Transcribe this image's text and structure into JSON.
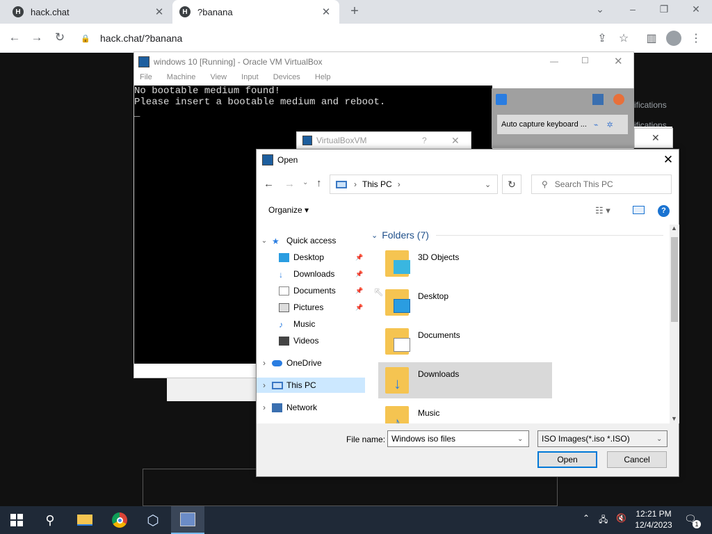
{
  "browser": {
    "tabs": [
      {
        "title": "hack.chat",
        "active": false
      },
      {
        "title": "?banana",
        "active": true
      }
    ],
    "url": "hack.chat/?banana"
  },
  "page_bg_text": {
    "line1": "ifications",
    "line2": "ifications"
  },
  "vbox": {
    "title": "windows 10 [Running] - Oracle VM VirtualBox",
    "menu": [
      "File",
      "Machine",
      "View",
      "Input",
      "Devices",
      "Help"
    ],
    "console": [
      "No bootable medium found!",
      "Please insert a bootable medium and reboot.",
      "_"
    ],
    "notice": "Auto capture keyboard ...",
    "vm_window_title": "VirtualBoxVM"
  },
  "dialog": {
    "title": "Open",
    "breadcrumb": "This PC",
    "search_placeholder": "Search This PC",
    "organize": "Organize",
    "nav": {
      "quick_access": "Quick access",
      "items": [
        "Desktop",
        "Downloads",
        "Documents",
        "Pictures",
        "Music",
        "Videos"
      ],
      "onedrive": "OneDrive",
      "this_pc": "This PC",
      "network": "Network"
    },
    "group_header": "Folders (7)",
    "folders": [
      "3D Objects",
      "Desktop",
      "Documents",
      "Downloads",
      "Music"
    ],
    "filename_label": "File name:",
    "filename_value": "Windows iso files",
    "filetype": "ISO Images(*.iso *.ISO)",
    "open_btn": "Open",
    "cancel_btn": "Cancel"
  },
  "taskbar": {
    "time": "12:21 PM",
    "date": "12/4/2023",
    "notification_count": "1"
  },
  "colors": {
    "accent": "#0078d7",
    "taskbar": "#1f2937",
    "folder": "#f5c451"
  }
}
